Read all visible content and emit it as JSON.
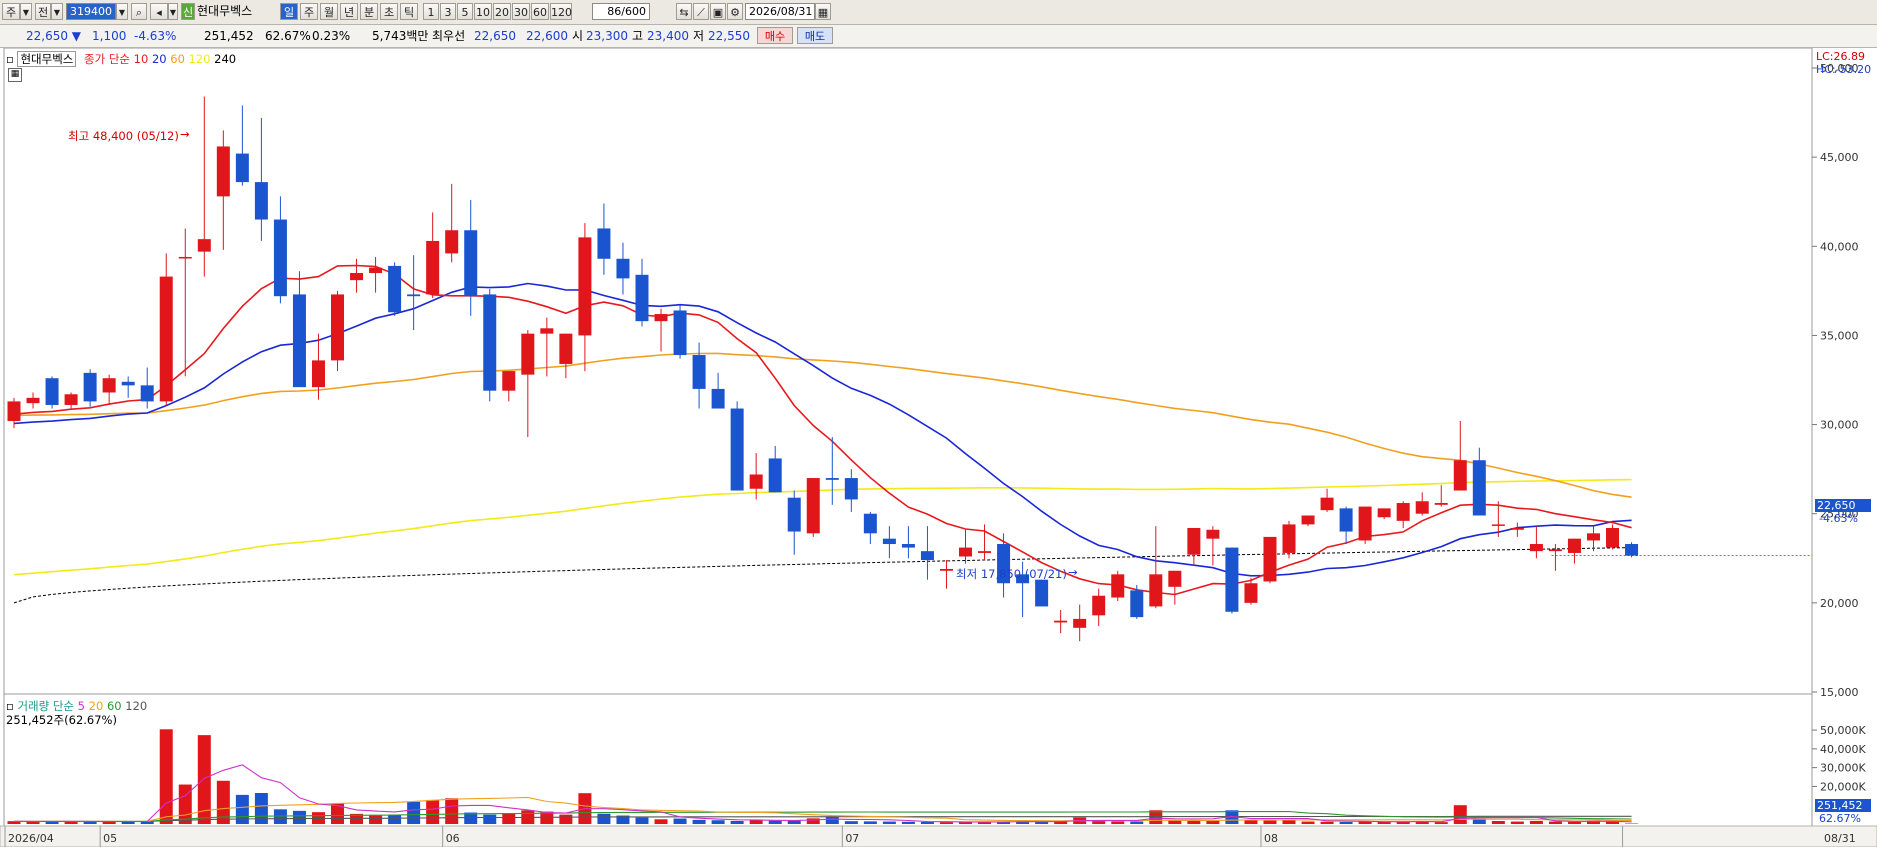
{
  "toolbar": {
    "market_btn": "주",
    "type_btn": "전",
    "code": "319400",
    "badge": "신",
    "name": "현대무벡스",
    "periods": [
      "일",
      "주",
      "월",
      "년",
      "분",
      "초",
      "틱"
    ],
    "intervals": [
      "1",
      "3",
      "5",
      "10",
      "20",
      "30",
      "60",
      "120"
    ],
    "count": "86/600",
    "date": "2026/08/31"
  },
  "quote": {
    "price": "22,650 ▼",
    "change": "1,100",
    "change_pct": "-4.63%",
    "volume": "251,452",
    "vol_ratio": "62.67%",
    "turnover_pct": "0.23%",
    "amount": "5,743백만",
    "best_label": "최우선",
    "ask": "22,650",
    "bid": "22,600",
    "open_label": "시",
    "open": "23,300",
    "high_label": "고",
    "high": "23,400",
    "low_label": "저",
    "low": "22,550",
    "buy": "매수",
    "sell": "매도"
  },
  "legend": {
    "stock": "현대무벡스",
    "close_label": "종가 단순",
    "ma": [
      "10",
      "20",
      "60",
      "120",
      "240"
    ],
    "lc": "LC:26.89",
    "hc": "HC:-53.20",
    "vol_title": "거래량 단순",
    "vol_ma": [
      "5",
      "20",
      "60",
      "120"
    ],
    "vol_info": "251,452주(62.67%)"
  },
  "annotations": {
    "high": "최고 48,400 (05/12)",
    "low": "최저 17,850 (07/21)",
    "last_price": "22,650",
    "last_pct": "-4.63%",
    "last_vol": "251,452",
    "last_vol_pct": "62.67%"
  },
  "colors": {
    "up": "#e0161b",
    "down": "#1a55cf",
    "ma10": "#e8191e",
    "ma20": "#1a27d6",
    "ma60": "#f0a020",
    "ma120": "#f2ea19",
    "ma240": "#000000"
  },
  "chart_data": {
    "type": "candlestick",
    "title": "",
    "price_axis": {
      "min": 15000,
      "max": 50000,
      "ticks": [
        50000,
        45000,
        40000,
        35000,
        30000,
        25000,
        20000,
        15000
      ]
    },
    "volume_axis": {
      "ticks": [
        50000,
        40000,
        30000,
        20000
      ],
      "unit": "K"
    },
    "x_labels": [
      {
        "i": 0,
        "label": "2026/04"
      },
      {
        "i": 5,
        "label": "05"
      },
      {
        "i": 23,
        "label": "06"
      },
      {
        "i": 44,
        "label": "07"
      },
      {
        "i": 66,
        "label": "08"
      },
      {
        "i": 85,
        "label": "08/31"
      }
    ],
    "candles": [
      [
        30200,
        31500,
        29800,
        31300
      ],
      [
        31200,
        31800,
        30900,
        31500
      ],
      [
        32600,
        32700,
        30900,
        31100
      ],
      [
        31100,
        31800,
        30900,
        31700
      ],
      [
        32900,
        33100,
        31000,
        31300
      ],
      [
        31800,
        32800,
        31100,
        32600
      ],
      [
        32400,
        32700,
        31500,
        32200
      ],
      [
        32200,
        33200,
        30900,
        31300
      ],
      [
        31300,
        39600,
        31100,
        38300
      ],
      [
        39400,
        41000,
        32700,
        39400
      ],
      [
        39700,
        48400,
        38300,
        40400
      ],
      [
        42800,
        46500,
        39800,
        45600
      ],
      [
        45200,
        47900,
        43400,
        43600
      ],
      [
        43600,
        47200,
        40300,
        41500
      ],
      [
        41500,
        42800,
        36800,
        37200
      ],
      [
        37300,
        38600,
        32800,
        32100
      ],
      [
        32100,
        35100,
        31400,
        33600
      ],
      [
        33600,
        37500,
        33000,
        37300
      ],
      [
        38100,
        39300,
        37400,
        38500
      ],
      [
        38500,
        39400,
        37400,
        38800
      ],
      [
        38900,
        39100,
        36100,
        36300
      ],
      [
        37300,
        39500,
        35300,
        37200
      ],
      [
        37300,
        41900,
        37100,
        40300
      ],
      [
        39600,
        43500,
        39100,
        40900
      ],
      [
        40900,
        42600,
        36100,
        37200
      ],
      [
        37300,
        37600,
        31300,
        31900
      ],
      [
        31900,
        33000,
        31300,
        33000
      ],
      [
        32800,
        35300,
        29300,
        35100
      ],
      [
        35100,
        36000,
        32700,
        35400
      ],
      [
        33400,
        35100,
        32600,
        35100
      ],
      [
        35000,
        41300,
        33000,
        40500
      ],
      [
        41000,
        42400,
        38400,
        39300
      ],
      [
        39300,
        40200,
        37300,
        38200
      ],
      [
        38400,
        39300,
        35500,
        35800
      ],
      [
        35800,
        36500,
        34100,
        36200
      ],
      [
        36400,
        36700,
        33700,
        33900
      ],
      [
        33900,
        34600,
        30900,
        32000
      ],
      [
        32000,
        32900,
        30900,
        30900
      ],
      [
        30900,
        31300,
        26300,
        26300
      ],
      [
        26400,
        28400,
        25800,
        27200
      ],
      [
        28100,
        28800,
        26200,
        26200
      ],
      [
        25900,
        26300,
        22700,
        24000
      ],
      [
        23900,
        27000,
        23700,
        27000
      ],
      [
        27000,
        29300,
        25500,
        26900
      ],
      [
        27000,
        27500,
        25100,
        25800
      ],
      [
        25000,
        25100,
        23300,
        23900
      ],
      [
        23600,
        24300,
        22500,
        23300
      ],
      [
        23300,
        24300,
        22500,
        23100
      ],
      [
        22900,
        24300,
        21300,
        22400
      ],
      [
        21800,
        22400,
        20800,
        21900
      ],
      [
        22600,
        24100,
        22200,
        23100
      ],
      [
        22800,
        24400,
        22400,
        22900
      ],
      [
        23300,
        23900,
        20300,
        21100
      ],
      [
        21600,
        22300,
        19200,
        21100
      ],
      [
        21300,
        21300,
        19800,
        19800
      ],
      [
        18900,
        19600,
        18300,
        19000
      ],
      [
        18600,
        19900,
        17850,
        19100
      ],
      [
        19300,
        20800,
        18700,
        20400
      ],
      [
        20300,
        21800,
        20100,
        21600
      ],
      [
        20700,
        21000,
        19100,
        19200
      ],
      [
        19800,
        24300,
        19700,
        21600
      ],
      [
        20900,
        21700,
        19900,
        21800
      ],
      [
        22700,
        23900,
        22100,
        24200
      ],
      [
        23600,
        24300,
        22100,
        24100
      ],
      [
        23100,
        23100,
        19400,
        19500
      ],
      [
        20000,
        21400,
        19900,
        21100
      ],
      [
        21200,
        23500,
        21100,
        23700
      ],
      [
        22800,
        24600,
        22500,
        24400
      ],
      [
        24400,
        24800,
        24300,
        24900
      ],
      [
        25200,
        26400,
        25100,
        25900
      ],
      [
        25300,
        25400,
        23300,
        24000
      ],
      [
        23500,
        25300,
        23300,
        25400
      ],
      [
        24800,
        25200,
        24700,
        25300
      ],
      [
        24600,
        25700,
        24200,
        25600
      ],
      [
        25000,
        26200,
        24900,
        25700
      ],
      [
        25500,
        26600,
        25400,
        25600
      ],
      [
        26300,
        30200,
        26300,
        28000
      ],
      [
        28000,
        28700,
        24900,
        24900
      ],
      [
        24400,
        25700,
        23700,
        24400
      ],
      [
        24100,
        24500,
        23700,
        24200
      ],
      [
        22900,
        24300,
        22500,
        23300
      ],
      [
        22900,
        23300,
        21800,
        23000
      ],
      [
        22800,
        23600,
        22200,
        23600
      ],
      [
        23500,
        24300,
        22900,
        23900
      ],
      [
        23100,
        24400,
        23000,
        24200
      ],
      [
        23300,
        23400,
        22550,
        22650
      ]
    ],
    "volumes": [
      1.5,
      1.3,
      1.4,
      1.4,
      1.3,
      1.3,
      1.3,
      1.3,
      50.4,
      21.0,
      47.3,
      23.0,
      15.5,
      16.5,
      7.8,
      7.0,
      6.3,
      11.0,
      5.4,
      4.5,
      5.0,
      11.8,
      12.8,
      13.7,
      6.1,
      5.0,
      5.4,
      7.3,
      6.6,
      5.0,
      16.4,
      5.5,
      4.5,
      3.4,
      2.5,
      2.9,
      2.2,
      2.0,
      1.6,
      2.2,
      1.8,
      2.0,
      3.0,
      4.0,
      1.5,
      1.4,
      1.3,
      1.2,
      1.1,
      1.0,
      1.1,
      1.3,
      1.2,
      1.4,
      1.2,
      1.6,
      3.5,
      1.9,
      1.4,
      1.3,
      7.3,
      1.9,
      1.6,
      1.8,
      7.3,
      1.9,
      1.8,
      2.2,
      1.3,
      1.2,
      1.1,
      1.5,
      1.1,
      1.3,
      1.3,
      1.0,
      10.0,
      2.8,
      1.6,
      1.3,
      1.6,
      1.3,
      1.2,
      1.7,
      1.3,
      0.25
    ],
    "ma240": {
      "from": 20000,
      "to": 23100
    }
  }
}
